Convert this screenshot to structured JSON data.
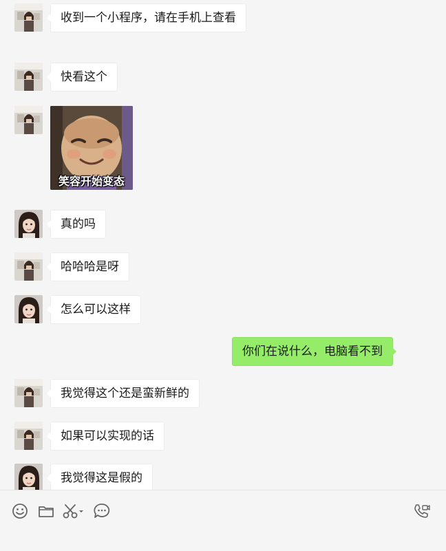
{
  "colors": {
    "background": "#f5f5f5",
    "incoming_bubble": "#ffffff",
    "outgoing_bubble": "#95ec69",
    "icon": "#666666"
  },
  "messages": [
    {
      "sender": "contact-a",
      "type": "text",
      "text": "收到一个小程序，请在手机上查看"
    },
    {
      "sender": "contact-a",
      "type": "text",
      "text": "快看这个"
    },
    {
      "sender": "contact-a",
      "type": "sticker",
      "caption": "笑容开始变态"
    },
    {
      "sender": "contact-b",
      "type": "text",
      "text": "真的吗"
    },
    {
      "sender": "contact-a",
      "type": "text",
      "text": "哈哈哈是呀"
    },
    {
      "sender": "contact-b",
      "type": "text",
      "text": "怎么可以这样"
    },
    {
      "sender": "me",
      "type": "text",
      "text": "你们在说什么，电脑看不到"
    },
    {
      "sender": "contact-a",
      "type": "text",
      "text": "我觉得这个还是蛮新鲜的"
    },
    {
      "sender": "contact-a",
      "type": "text",
      "text": "如果可以实现的话"
    },
    {
      "sender": "contact-b",
      "type": "text",
      "text": "我觉得这是假的"
    }
  ],
  "toolbar": {
    "icons": [
      "emoji-icon",
      "folder-icon",
      "scissors-icon",
      "chat-bubble-icon",
      "video-call-icon"
    ]
  }
}
